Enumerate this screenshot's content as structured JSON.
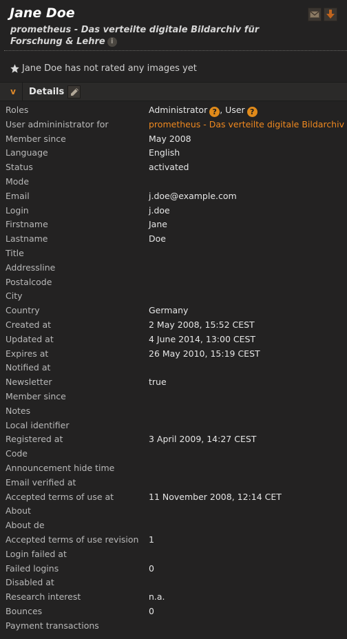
{
  "header": {
    "name": "Jane Doe",
    "institution": "prometheus - Das verteilte digitale Bildarchiv für Forschung & Lehre",
    "info_icon": "i"
  },
  "icons": {
    "mail": "mail-icon",
    "download": "download-icon",
    "info": "info-icon",
    "star": "star-icon",
    "toggle": "chevron-down-icon",
    "edit": "pencil-icon",
    "help": "question-icon"
  },
  "rating_text": "Jane Doe has not rated any images yet",
  "details": {
    "toggle_glyph": "v",
    "title": "Details",
    "roles": {
      "label": "Roles",
      "role1": "Administrator",
      "sep": ", ",
      "role2": "User",
      "help": "?"
    },
    "admin_for": {
      "label": "User admininistrator for",
      "value": "prometheus - Das verteilte digitale Bildarchiv für Forschung & Lehre"
    },
    "rows": [
      {
        "label": "Member since",
        "value": "May 2008"
      },
      {
        "label": "Language",
        "value": "English"
      },
      {
        "label": "Status",
        "value": "activated"
      },
      {
        "label": "Mode",
        "value": ""
      },
      {
        "label": "Email",
        "value": "j.doe@example.com"
      },
      {
        "label": "Login",
        "value": "j.doe"
      },
      {
        "label": "Firstname",
        "value": "Jane"
      },
      {
        "label": "Lastname",
        "value": "Doe"
      },
      {
        "label": "Title",
        "value": ""
      },
      {
        "label": "Addressline",
        "value": ""
      },
      {
        "label": "Postalcode",
        "value": ""
      },
      {
        "label": "City",
        "value": ""
      },
      {
        "label": "Country",
        "value": "Germany"
      },
      {
        "label": "Created at",
        "value": "2 May 2008, 15:52 CEST"
      },
      {
        "label": "Updated at",
        "value": "4 June 2014, 13:00 CEST"
      },
      {
        "label": "Expires at",
        "value": "26 May 2010, 15:19 CEST"
      },
      {
        "label": "Notified at",
        "value": ""
      },
      {
        "label": "Newsletter",
        "value": "true"
      },
      {
        "label": "Member since",
        "value": ""
      },
      {
        "label": "Notes",
        "value": ""
      },
      {
        "label": "Local identifier",
        "value": ""
      },
      {
        "label": "Registered at",
        "value": "3 April 2009, 14:27 CEST"
      },
      {
        "label": "Code",
        "value": ""
      },
      {
        "label": "Announcement hide time",
        "value": ""
      },
      {
        "label": "Email verified at",
        "value": ""
      },
      {
        "label": "Accepted terms of use at",
        "value": "11 November 2008, 12:14 CET"
      },
      {
        "label": "About",
        "value": ""
      },
      {
        "label": "About de",
        "value": ""
      },
      {
        "label": "Accepted terms of use revision",
        "value": "1"
      },
      {
        "label": "Login failed at",
        "value": ""
      },
      {
        "label": "Failed logins",
        "value": "0"
      },
      {
        "label": "Disabled at",
        "value": ""
      },
      {
        "label": "Research interest",
        "value": "n.a."
      },
      {
        "label": "Bounces",
        "value": "0"
      },
      {
        "label": "Payment transactions",
        "value": ""
      }
    ]
  },
  "colors": {
    "background": "#232222",
    "accent": "#e08a1a",
    "link": "#f0891f"
  }
}
